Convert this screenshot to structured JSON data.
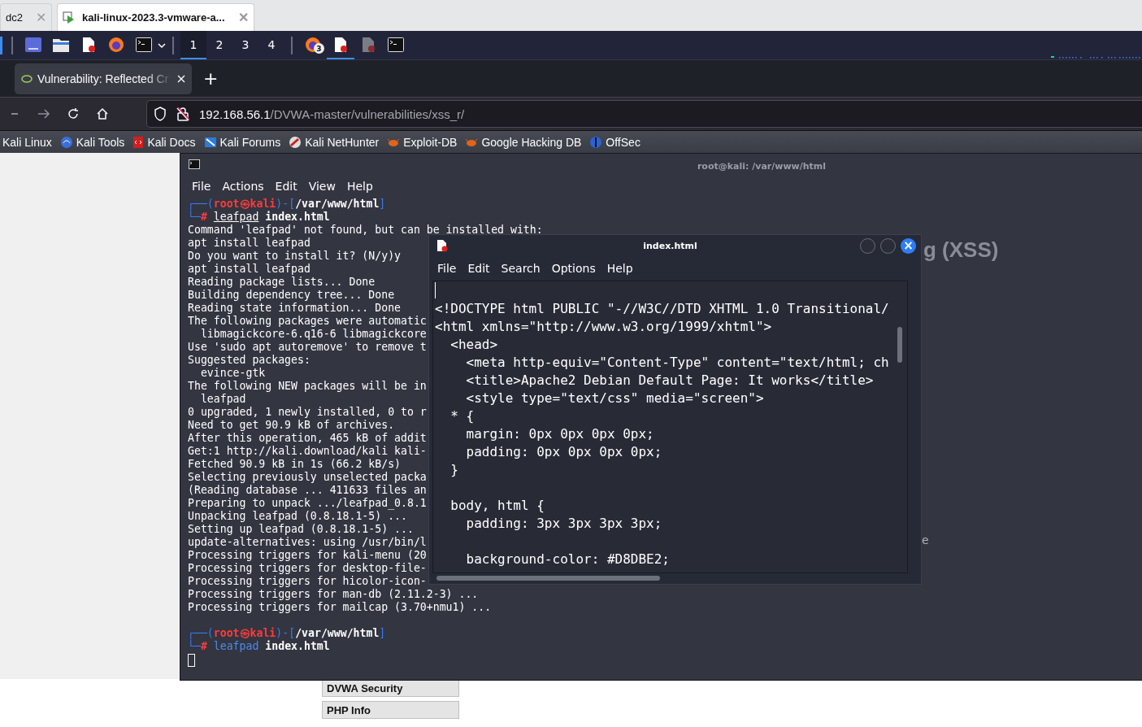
{
  "host_tabs": [
    {
      "label": "dc2",
      "selected": false,
      "close": "✕"
    },
    {
      "label": "kali-linux-2023.3-vmware-a...",
      "selected": true,
      "close": "✕"
    }
  ],
  "panel": {
    "launchers": [
      {
        "kind": "menu"
      },
      {
        "kind": "folder"
      },
      {
        "kind": "editor"
      },
      {
        "kind": "browser"
      },
      {
        "kind": "terminal"
      }
    ],
    "workspaces": [
      {
        "label": "1",
        "selected": true
      },
      {
        "label": "2",
        "selected": false
      },
      {
        "label": "3",
        "selected": false
      },
      {
        "label": "4",
        "selected": false
      }
    ],
    "tasks": [
      {
        "kind": "browser",
        "badge": "3",
        "selected": false
      },
      {
        "kind": "editor",
        "selected": true
      },
      {
        "kind": "editor-dim",
        "selected": false
      },
      {
        "kind": "terminal",
        "selected": false
      }
    ]
  },
  "browser": {
    "tab": {
      "title": "Vulnerability: Reflected Cr"
    },
    "new_tab": "+",
    "url": {
      "host": "192.168.56.1",
      "path": "/DVWA-master/vulnerabilities/xss_r/"
    },
    "bookmarks": [
      "Kali Linux",
      "Kali Tools",
      "Kali Docs",
      "Kali Forums",
      "Kali NetHunter",
      "Exploit-DB",
      "Google Hacking DB",
      "OffSec"
    ]
  },
  "page": {
    "heading_fragment": "g (XSS)",
    "text_fragment": "e",
    "menu": [
      "DVWA Security",
      "PHP Info"
    ]
  },
  "terminal": {
    "title": "root@kali: /var/www/html",
    "menu": [
      "File",
      "Actions",
      "Edit",
      "View",
      "Help"
    ],
    "lines": [
      {
        "kind": "prompt",
        "pre": "┌──(",
        "user": "root",
        "at": "㉿",
        "host": "kali",
        "mid": ")-[",
        "path": "/var/www/html",
        "post": "]",
        "pre2": "└─",
        "mark": "#",
        "command": "leafpad",
        "known": false,
        "args": "index.html"
      },
      {
        "kind": "text",
        "text": "Command 'leafpad' not found, but can be installed with:"
      },
      {
        "kind": "text",
        "text": "apt install leafpad"
      },
      {
        "kind": "text",
        "text": "Do you want to install it? (N/y)y"
      },
      {
        "kind": "text",
        "text": "apt install leafpad"
      },
      {
        "kind": "text",
        "text": "Reading package lists... Done"
      },
      {
        "kind": "text",
        "text": "Building dependency tree... Done"
      },
      {
        "kind": "text",
        "text": "Reading state information... Done"
      },
      {
        "kind": "text",
        "text": "The following packages were automatic"
      },
      {
        "kind": "text",
        "text": "  libmagickcore-6.q16-6 libmagickcore"
      },
      {
        "kind": "text",
        "text": "Use 'sudo apt autoremove' to remove t"
      },
      {
        "kind": "text",
        "text": "Suggested packages:"
      },
      {
        "kind": "text",
        "text": "  evince-gtk"
      },
      {
        "kind": "text",
        "text": "The following NEW packages will be in"
      },
      {
        "kind": "text",
        "text": "  leafpad"
      },
      {
        "kind": "text",
        "text": "0 upgraded, 1 newly installed, 0 to r"
      },
      {
        "kind": "text",
        "text": "Need to get 90.9 kB of archives."
      },
      {
        "kind": "text",
        "text": "After this operation, 465 kB of addit"
      },
      {
        "kind": "text",
        "text": "Get:1 http://kali.download/kali kali-"
      },
      {
        "kind": "text",
        "text": "Fetched 90.9 kB in 1s (66.2 kB/s)"
      },
      {
        "kind": "text",
        "text": "Selecting previously unselected packa"
      },
      {
        "kind": "text",
        "text": "(Reading database ... 411633 files an"
      },
      {
        "kind": "text",
        "text": "Preparing to unpack .../leafpad_0.8.1"
      },
      {
        "kind": "text",
        "text": "Unpacking leafpad (0.8.18.1-5) ..."
      },
      {
        "kind": "text",
        "text": "Setting up leafpad (0.8.18.1-5) ..."
      },
      {
        "kind": "text",
        "text": "update-alternatives: using /usr/bin/l"
      },
      {
        "kind": "text",
        "text": "Processing triggers for kali-menu (20"
      },
      {
        "kind": "text",
        "text": "Processing triggers for desktop-file-"
      },
      {
        "kind": "text",
        "text": "Processing triggers for hicolor-icon-"
      },
      {
        "kind": "text",
        "text": "Processing triggers for man-db (2.11.2-3) ..."
      },
      {
        "kind": "text",
        "text": "Processing triggers for mailcap (3.70+nmu1) ..."
      },
      {
        "kind": "blank"
      },
      {
        "kind": "prompt",
        "pre": "┌──(",
        "user": "root",
        "at": "㉿",
        "host": "kali",
        "mid": ")-[",
        "path": "/var/www/html",
        "post": "]",
        "pre2": "└─",
        "mark": "#",
        "command": "leafpad",
        "known": true,
        "args": "index.html"
      },
      {
        "kind": "cursor"
      }
    ]
  },
  "editor": {
    "title": "index.html",
    "close": "×",
    "menu": [
      "File",
      "Edit",
      "Search",
      "Options",
      "Help"
    ],
    "lines": [
      {
        "kind": "caret"
      },
      {
        "kind": "code",
        "text": "<!DOCTYPE html PUBLIC \"-//W3C//DTD XHTML 1.0 Transitional/"
      },
      {
        "kind": "code",
        "text": "<html xmlns=\"http://www.w3.org/1999/xhtml\">"
      },
      {
        "kind": "code",
        "text": "  <head>"
      },
      {
        "kind": "code",
        "text": "    <meta http-equiv=\"Content-Type\" content=\"text/html; ch"
      },
      {
        "kind": "code",
        "text": "    <title>Apache2 Debian Default Page: It works</title>"
      },
      {
        "kind": "code",
        "text": "    <style type=\"text/css\" media=\"screen\">"
      },
      {
        "kind": "code",
        "text": "  * {"
      },
      {
        "kind": "code",
        "text": "    margin: 0px 0px 0px 0px;"
      },
      {
        "kind": "code",
        "text": "    padding: 0px 0px 0px 0px;"
      },
      {
        "kind": "code",
        "text": "  }"
      },
      {
        "kind": "blank"
      },
      {
        "kind": "code",
        "text": "  body, html {"
      },
      {
        "kind": "code",
        "text": "    padding: 3px 3px 3px 3px;"
      },
      {
        "kind": "blank"
      },
      {
        "kind": "code",
        "text": "    background-color: #D8DBE2;"
      }
    ]
  }
}
